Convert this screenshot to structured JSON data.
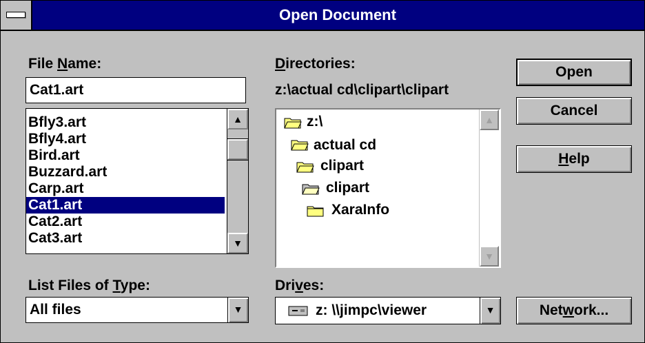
{
  "window": {
    "title": "Open Document"
  },
  "file_name": {
    "label_pre": "File ",
    "label_u": "N",
    "label_post": "ame:",
    "value": "Cat1.art"
  },
  "files": {
    "items": [
      "Bfly3.art",
      "Bfly4.art",
      "Bird.art",
      "Buzzard.art",
      "Carp.art",
      "Cat1.art",
      "Cat2.art",
      "Cat3.art"
    ],
    "selected": "Cat1.art"
  },
  "directories": {
    "label_u": "D",
    "label_post": "irectories:",
    "path": "z:\\actual cd\\clipart\\clipart",
    "tree": [
      "z:\\",
      "actual cd",
      "clipart",
      "clipart",
      "XaraInfo"
    ]
  },
  "list_type": {
    "label_pre": "List Files of ",
    "label_u": "T",
    "label_post": "ype:",
    "value": "All files"
  },
  "drives": {
    "label_pre": "Dri",
    "label_u": "v",
    "label_post": "es:",
    "value": "z: \\\\jimpc\\viewer"
  },
  "buttons": {
    "open": "Open",
    "cancel": "Cancel",
    "help_u": "H",
    "help_post": "elp",
    "network_pre": "Net",
    "network_u": "w",
    "network_post": "ork..."
  },
  "icons": {
    "system_menu": "system-menu-icon",
    "folder": "folder-icon",
    "drive": "network-drive-icon",
    "arrow_up": "scroll-up-arrow-icon",
    "arrow_down": "scroll-down-arrow-icon"
  }
}
